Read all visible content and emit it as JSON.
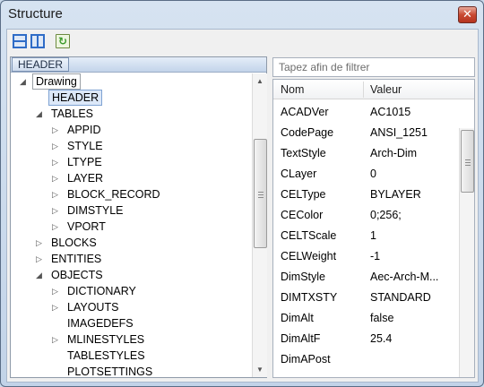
{
  "window": {
    "title": "Structure",
    "close_glyph": "✕"
  },
  "toolbar": {
    "buttons": [
      {
        "name": "split-horizontal-icon"
      },
      {
        "name": "split-vertical-icon"
      },
      {
        "name": "refresh-icon"
      }
    ]
  },
  "breadcrumb": {
    "items": [
      "HEADER"
    ]
  },
  "tree": {
    "nodes": [
      {
        "label": "Drawing",
        "level": 0,
        "expander": "expanded",
        "style": "boxed"
      },
      {
        "label": "HEADER",
        "level": 1,
        "expander": "none",
        "style": "selected"
      },
      {
        "label": "TABLES",
        "level": 1,
        "expander": "expanded",
        "style": "normal"
      },
      {
        "label": "APPID",
        "level": 2,
        "expander": "collapsed",
        "style": "normal"
      },
      {
        "label": "STYLE",
        "level": 2,
        "expander": "collapsed",
        "style": "normal"
      },
      {
        "label": "LTYPE",
        "level": 2,
        "expander": "collapsed",
        "style": "normal"
      },
      {
        "label": "LAYER",
        "level": 2,
        "expander": "collapsed",
        "style": "normal"
      },
      {
        "label": "BLOCK_RECORD",
        "level": 2,
        "expander": "collapsed",
        "style": "normal"
      },
      {
        "label": "DIMSTYLE",
        "level": 2,
        "expander": "collapsed",
        "style": "normal"
      },
      {
        "label": "VPORT",
        "level": 2,
        "expander": "collapsed",
        "style": "normal"
      },
      {
        "label": "BLOCKS",
        "level": 1,
        "expander": "collapsed",
        "style": "normal"
      },
      {
        "label": "ENTITIES",
        "level": 1,
        "expander": "collapsed",
        "style": "normal"
      },
      {
        "label": "OBJECTS",
        "level": 1,
        "expander": "expanded",
        "style": "normal"
      },
      {
        "label": "DICTIONARY",
        "level": 2,
        "expander": "collapsed",
        "style": "normal"
      },
      {
        "label": "LAYOUTS",
        "level": 2,
        "expander": "collapsed",
        "style": "normal"
      },
      {
        "label": "IMAGEDEFS",
        "level": 2,
        "expander": "none",
        "style": "normal"
      },
      {
        "label": "MLINESTYLES",
        "level": 2,
        "expander": "collapsed",
        "style": "normal"
      },
      {
        "label": "TABLESTYLES",
        "level": 2,
        "expander": "none",
        "style": "normal"
      },
      {
        "label": "PLOTSETTINGS",
        "level": 2,
        "expander": "none",
        "style": "normal"
      }
    ]
  },
  "filter": {
    "placeholder": "Tapez afin de filtrer"
  },
  "grid": {
    "columns": [
      "Nom",
      "Valeur"
    ],
    "rows": [
      [
        "ACADVer",
        "AC1015"
      ],
      [
        "CodePage",
        "ANSI_1251"
      ],
      [
        "TextStyle",
        "Arch-Dim"
      ],
      [
        "CLayer",
        "0"
      ],
      [
        "CELType",
        "BYLAYER"
      ],
      [
        "CEColor",
        "0;256;"
      ],
      [
        "CELTScale",
        "1"
      ],
      [
        "CELWeight",
        "-1"
      ],
      [
        "DimStyle",
        "Aec-Arch-M..."
      ],
      [
        "DIMTXSTY",
        "STANDARD"
      ],
      [
        "DimAlt",
        "false"
      ],
      [
        "DimAltF",
        "25.4"
      ],
      [
        "DimAPost",
        ""
      ]
    ]
  },
  "scroll": {
    "tree_thumb_fraction": 0.4,
    "grid_thumb_fraction": 0.25
  }
}
